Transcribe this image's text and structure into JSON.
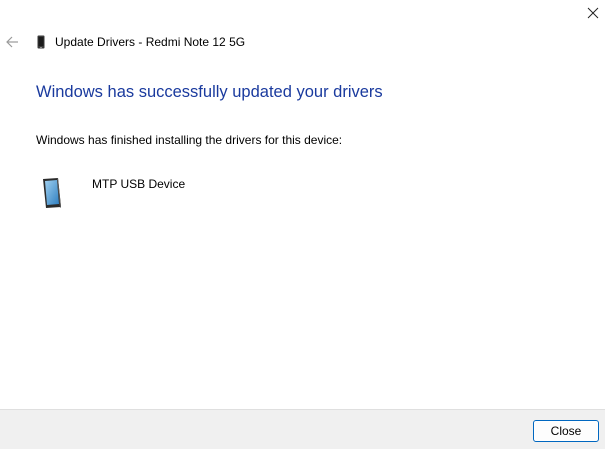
{
  "window": {
    "title": "Update Drivers - Redmi Note 12 5G"
  },
  "icons": {
    "close": "close-icon",
    "back": "back-arrow-icon",
    "title_device": "phone-icon",
    "device": "phone-device-icon"
  },
  "main": {
    "heading": "Windows has successfully updated your drivers",
    "description": "Windows has finished installing the drivers for this device:",
    "device_name": "MTP USB Device"
  },
  "footer": {
    "close_label": "Close"
  },
  "colors": {
    "heading": "#1a3a9e",
    "footer_bg": "#f0f0f0",
    "button_border": "#0067c0"
  }
}
